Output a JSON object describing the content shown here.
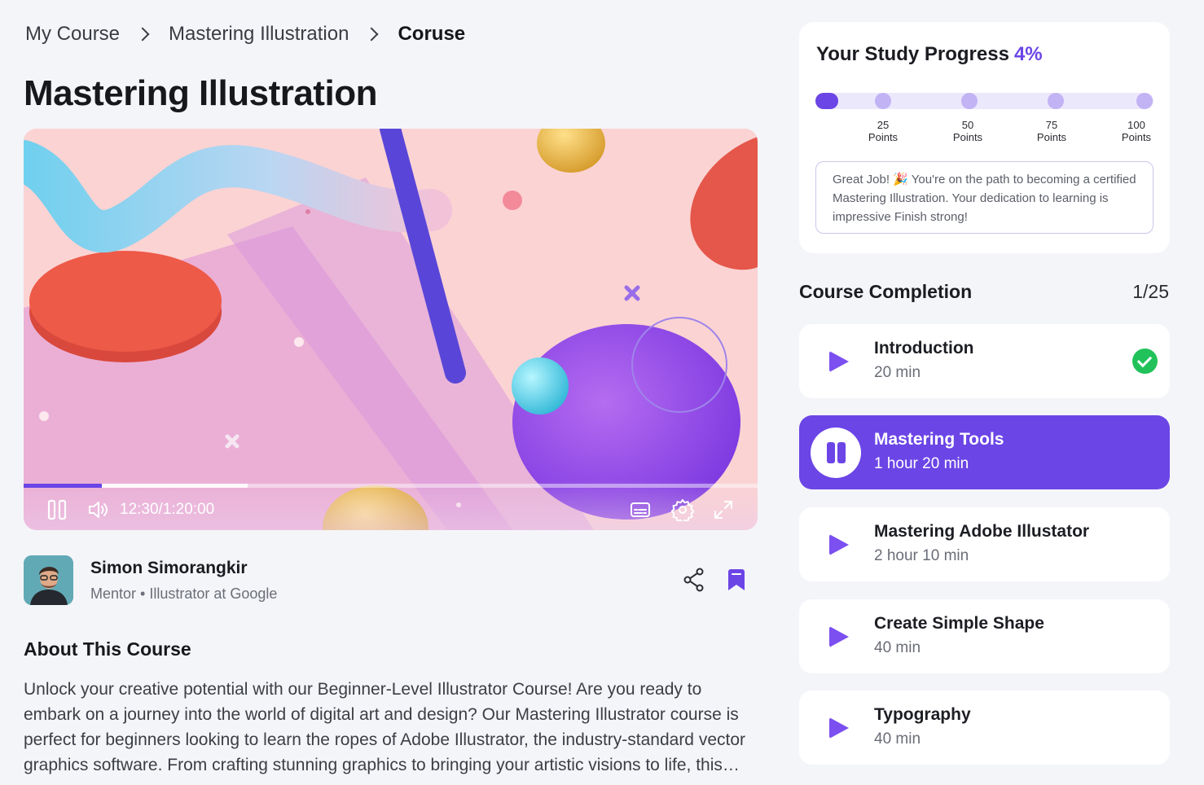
{
  "breadcrumb": {
    "items": [
      "My Course",
      "Mastering Illustration"
    ],
    "current": "Coruse"
  },
  "page": {
    "title": "Mastering Illustration"
  },
  "video": {
    "time": "12:30/1:20:00",
    "played_fraction": 0.107,
    "buffered_fraction": 0.305,
    "controls": [
      "pause-icon",
      "volume-icon",
      "subtitles-icon",
      "settings-icon",
      "fullscreen-icon"
    ]
  },
  "mentor": {
    "name": "Simon Simorangkir",
    "role": "Mentor • Illustrator at Google"
  },
  "about": {
    "title": "About This Course",
    "text": "Unlock your creative potential with our Beginner-Level Illustrator Course! Are you ready to embark on a journey into the world of digital art and design? Our Mastering Illustrator course is perfect for beginners looking to learn the ropes of Adobe Illustrator, the industry-standard vector graphics software. From crafting stunning graphics to bringing your artistic visions to life, this course covers everything you need."
  },
  "study_progress": {
    "title": "Your Study Progress",
    "percent_label": "4%",
    "percent": 4,
    "milestones": [
      {
        "value": "25",
        "unit": "Points"
      },
      {
        "value": "50",
        "unit": "Points"
      },
      {
        "value": "75",
        "unit": "Points"
      },
      {
        "value": "100",
        "unit": "Points"
      }
    ],
    "message": "Great Job! 🎉 You're on the path to becoming a certified Mastering Illustration. Your dedication to learning is impressive Finish strong!"
  },
  "completion": {
    "title": "Course Completion",
    "count": "1/25",
    "lessons": [
      {
        "title": "Introduction",
        "duration": "20 min",
        "state": "completed"
      },
      {
        "title": "Mastering Tools",
        "duration": "1 hour 20 min",
        "state": "playing"
      },
      {
        "title": "Mastering Adobe Illustator",
        "duration": "2 hour 10 min",
        "state": "locked"
      },
      {
        "title": "Create Simple Shape",
        "duration": "40 min",
        "state": "locked"
      },
      {
        "title": "Typography",
        "duration": "40 min",
        "state": "locked"
      }
    ]
  },
  "colors": {
    "accent": "#6b45e6",
    "success": "#22c25b",
    "background": "#f4f5f8"
  }
}
